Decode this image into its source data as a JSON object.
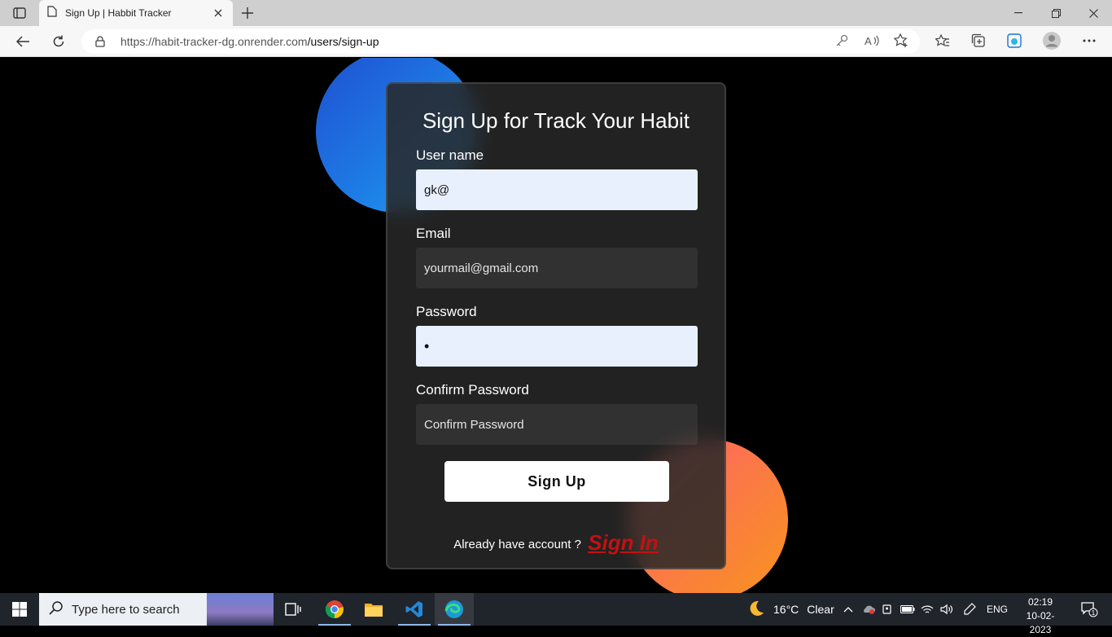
{
  "browser": {
    "tab_title": "Sign Up | Habbit Tracker",
    "url_host": "https://habit-tracker-dg.onrender.com",
    "url_path": "/users/sign-up"
  },
  "form": {
    "heading": "Sign Up for Track Your Habit",
    "username_label": "User name",
    "username_value": "gk@",
    "email_label": "Email",
    "email_placeholder": "yourmail@gmail.com",
    "password_label": "Password",
    "password_value": "•",
    "confirm_label": "Confirm Password",
    "confirm_placeholder": "Confirm Password",
    "submit_label": "Sign Up",
    "already_text": "Already have account ?",
    "signin_link": "Sign In"
  },
  "taskbar": {
    "search_placeholder": "Type here to search",
    "weather_temp": "16°C",
    "weather_desc": "Clear",
    "language": "ENG",
    "time": "02:19",
    "date": "10-02-2023",
    "notification_count": "1"
  },
  "colors": {
    "accent_blue": "#1d7fe6",
    "accent_orange": "#f7941d",
    "link_red": "#c01212"
  }
}
